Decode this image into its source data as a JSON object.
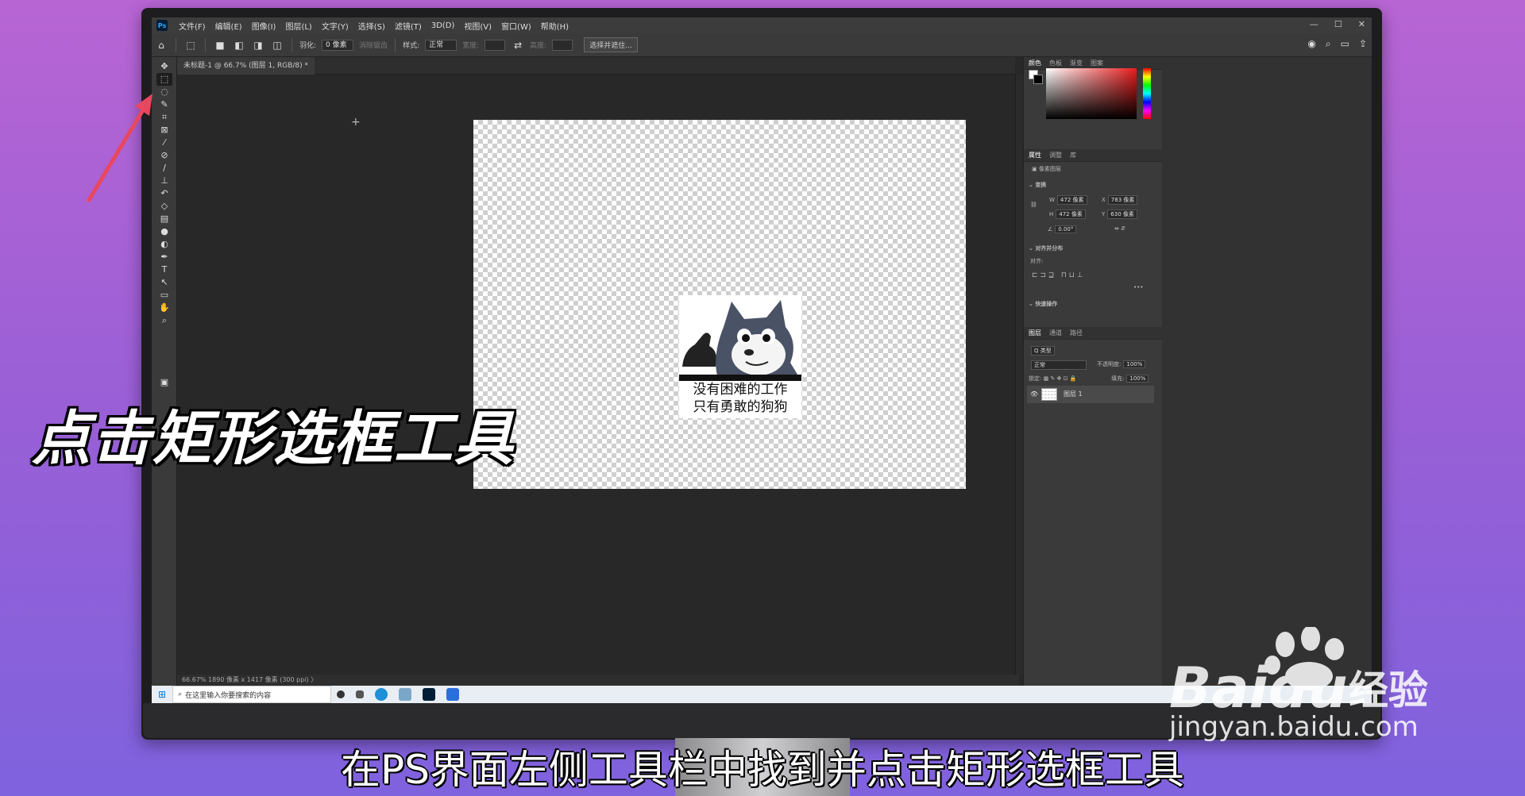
{
  "menubar": {
    "logo": "Ps",
    "items": [
      "文件(F)",
      "编辑(E)",
      "图像(I)",
      "图层(L)",
      "文字(Y)",
      "选择(S)",
      "滤镜(T)",
      "3D(D)",
      "视图(V)",
      "窗口(W)",
      "帮助(H)"
    ],
    "controls": [
      "—",
      "☐",
      "✕"
    ]
  },
  "options": {
    "feather_label": "羽化:",
    "feather_value": "0 像素",
    "antialias": "消除锯齿",
    "style_label": "样式:",
    "style_value": "正常",
    "width_label": "宽度:",
    "height_label": "高度:",
    "select_mask_button": "选择并遮住..."
  },
  "document": {
    "tab_title": "未标题-1 @ 66.7% (图层 1, RGB/8) *",
    "status": "66.67%   1890 像素 x 1417 像素 (300 ppi)   〉",
    "meme_text_line1": "没有困难的工作",
    "meme_text_line2": "只有勇敢的狗狗"
  },
  "panels": {
    "color_tabs": [
      "颜色",
      "色板",
      "渐变",
      "图案"
    ],
    "props_tabs": [
      "属性",
      "调整",
      "库"
    ],
    "pixel_layer": "像素图层",
    "transform": "变换",
    "w": "472 像素",
    "x": "783 像素",
    "h": "472 像素",
    "y": "630 像素",
    "angle": "0.00°",
    "align_section": "对齐并分布",
    "align_label": "对齐:",
    "quick_actions": "快速操作",
    "layer_tabs": [
      "图层",
      "通道",
      "路径"
    ],
    "kind_label": "Q 类型",
    "blend_mode": "正常",
    "opacity_label": "不透明度:",
    "opacity_value": "100%",
    "lock_label": "锁定:",
    "fill_label": "填充:",
    "fill_value": "100%",
    "layer_name": "图层 1"
  },
  "taskbar": {
    "search_placeholder": "在这里输入你要搜索的内容"
  },
  "overlay": {
    "big_caption": "点击矩形选框工具",
    "subtitle": "在PS界面左侧工具栏中找到并点击矩形选框工具",
    "watermark_brand": "Baidu",
    "watermark_cn": "经验",
    "watermark_url": "jingyan.baidu.com",
    "arrow_color": "#e8475f"
  }
}
